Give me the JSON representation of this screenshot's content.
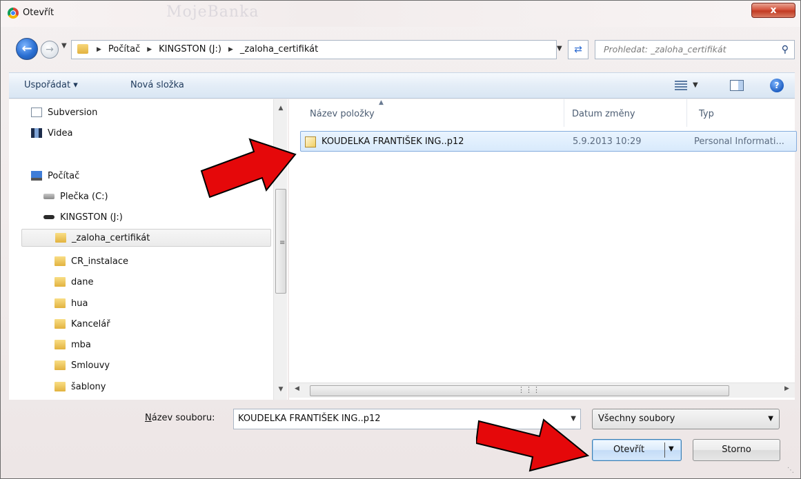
{
  "window": {
    "title": "Otevřít",
    "close_label": "x",
    "background_ghost": "MojeBanka"
  },
  "nav": {
    "breadcrumb": [
      "Počítač",
      "KINGSTON (J:)",
      "_zaloha_certifikát"
    ],
    "search_placeholder": "Prohledat: _zaloha_certifikát"
  },
  "toolbar": {
    "organize_label": "Uspořádat ▾",
    "new_folder_label": "Nová složka"
  },
  "tree": {
    "items": [
      {
        "label": "Subversion",
        "icon": "document-icon"
      },
      {
        "label": "Videa",
        "icon": "video-icon"
      },
      {
        "label": "Počítač",
        "icon": "computer-icon"
      },
      {
        "label": "Plečka (C:)",
        "icon": "hard-drive-icon"
      },
      {
        "label": "KINGSTON (J:)",
        "icon": "usb-drive-icon"
      },
      {
        "label": "_zaloha_certifikát",
        "icon": "folder-icon",
        "selected": true
      },
      {
        "label": "CR_instalace",
        "icon": "folder-icon"
      },
      {
        "label": "dane",
        "icon": "folder-icon"
      },
      {
        "label": "hua",
        "icon": "folder-icon"
      },
      {
        "label": "Kancelář",
        "icon": "folder-icon"
      },
      {
        "label": "mba",
        "icon": "folder-icon"
      },
      {
        "label": "Smlouvy",
        "icon": "folder-icon"
      },
      {
        "label": "šablony",
        "icon": "folder-icon"
      }
    ]
  },
  "file_list": {
    "columns": [
      "Název položky",
      "Datum změny",
      "Typ"
    ],
    "rows": [
      {
        "name": "KOUDELKA FRANTIŠEK ING..p12",
        "date": "5.9.2013 10:29",
        "type": "Personal Informati..."
      }
    ]
  },
  "footer": {
    "filename_label_underlined": "N",
    "filename_label_rest": "ázev souboru:",
    "filename_value": "KOUDELKA FRANTIŠEK ING..p12",
    "filter_value": "Všechny soubory",
    "open_label": "Otevřít",
    "cancel_label": "Storno"
  },
  "colors": {
    "arrow": "#e5080a",
    "selection": "#d8eafc",
    "accent": "#3c7fb1"
  }
}
